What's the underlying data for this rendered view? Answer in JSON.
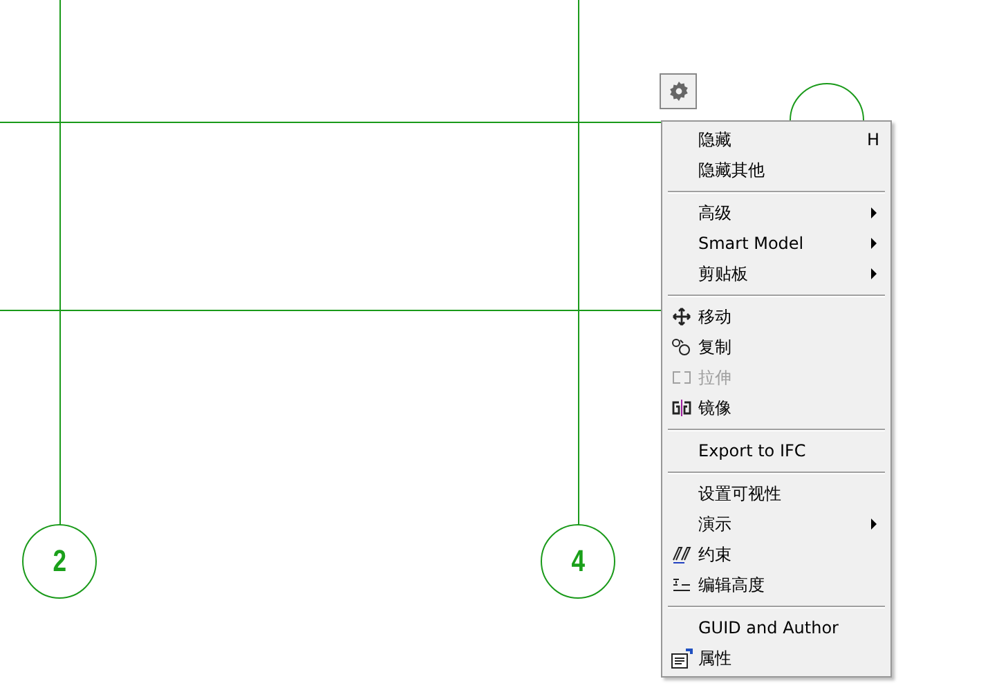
{
  "grid_bubbles": [
    {
      "label": "2"
    },
    {
      "label": "4"
    }
  ],
  "menu": {
    "items": [
      {
        "kind": "item",
        "label": "隐藏",
        "shortcut": "H"
      },
      {
        "kind": "item",
        "label": "隐藏其他"
      },
      {
        "kind": "separator"
      },
      {
        "kind": "item",
        "label": "高级",
        "submenu": true
      },
      {
        "kind": "item",
        "label": "Smart Model",
        "submenu": true
      },
      {
        "kind": "item",
        "label": "剪贴板",
        "submenu": true
      },
      {
        "kind": "separator"
      },
      {
        "kind": "item",
        "label": "移动"
      },
      {
        "kind": "item",
        "label": "复制"
      },
      {
        "kind": "item",
        "label": "拉伸",
        "disabled": true
      },
      {
        "kind": "item",
        "label": "镜像"
      },
      {
        "kind": "separator"
      },
      {
        "kind": "item",
        "label": "Export to IFC"
      },
      {
        "kind": "separator"
      },
      {
        "kind": "item",
        "label": "设置可视性"
      },
      {
        "kind": "item",
        "label": "演示",
        "submenu": true
      },
      {
        "kind": "item",
        "label": "约束"
      },
      {
        "kind": "item",
        "label": "编辑高度"
      },
      {
        "kind": "separator"
      },
      {
        "kind": "item",
        "label": "GUID and Author"
      },
      {
        "kind": "item",
        "label": "属性"
      }
    ]
  }
}
